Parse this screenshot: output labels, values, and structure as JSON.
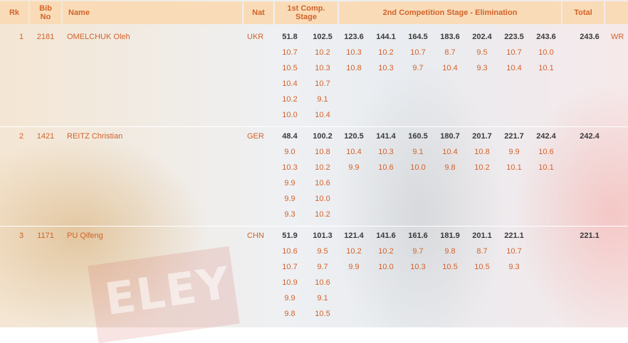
{
  "header": {
    "rank": "Rk",
    "bib_line1": "Bib",
    "bib_line2": "No",
    "name": "Name",
    "nat": "Nat",
    "stage1_line1": "1st Comp.",
    "stage1_line2": "Stage",
    "stage2": "2nd Competition Stage - Elimination",
    "total": "Total"
  },
  "background_logo_text": "ELEY",
  "athletes": [
    {
      "rank": "1",
      "bib": "2181",
      "name": "OMELCHUK Oleh",
      "nat": "UKR",
      "stage1_totals": [
        "51.8",
        "102.5"
      ],
      "stage1_shots": [
        [
          "10.7",
          "10.2"
        ],
        [
          "10.5",
          "10.3"
        ],
        [
          "10.4",
          "10.7"
        ],
        [
          "10.2",
          "9.1"
        ],
        [
          "10.0",
          "10.4"
        ]
      ],
      "stage2_totals": [
        "123.6",
        "144.1",
        "164.5",
        "183.6",
        "202.4",
        "223.5",
        "243.6"
      ],
      "stage2_shots": [
        [
          "10.3",
          "10.2",
          "10.7",
          "8.7",
          "9.5",
          "10.7",
          "10.0"
        ],
        [
          "10.8",
          "10.3",
          "9.7",
          "10.4",
          "9.3",
          "10.4",
          "10.1"
        ]
      ],
      "total": "243.6",
      "record": "WR"
    },
    {
      "rank": "2",
      "bib": "1421",
      "name": "REITZ Christian",
      "nat": "GER",
      "stage1_totals": [
        "48.4",
        "100.2"
      ],
      "stage1_shots": [
        [
          "9.0",
          "10.8"
        ],
        [
          "10.3",
          "10.2"
        ],
        [
          "9.9",
          "10.6"
        ],
        [
          "9.9",
          "10.0"
        ],
        [
          "9.3",
          "10.2"
        ]
      ],
      "stage2_totals": [
        "120.5",
        "141.4",
        "160.5",
        "180.7",
        "201.7",
        "221.7",
        "242.4"
      ],
      "stage2_shots": [
        [
          "10.4",
          "10.3",
          "9.1",
          "10.4",
          "10.8",
          "9.9",
          "10.6"
        ],
        [
          "9.9",
          "10.6",
          "10.0",
          "9.8",
          "10.2",
          "10.1",
          "10.1"
        ]
      ],
      "total": "242.4",
      "record": ""
    },
    {
      "rank": "3",
      "bib": "1171",
      "name": "PU Qifeng",
      "nat": "CHN",
      "stage1_totals": [
        "51.9",
        "101.3"
      ],
      "stage1_shots": [
        [
          "10.6",
          "9.5"
        ],
        [
          "10.7",
          "9.7"
        ],
        [
          "10.9",
          "10.6"
        ],
        [
          "9.9",
          "9.1"
        ],
        [
          "9.8",
          "10.5"
        ]
      ],
      "stage2_totals": [
        "121.4",
        "141.6",
        "161.6",
        "181.9",
        "201.1",
        "221.1"
      ],
      "stage2_shots": [
        [
          "10.2",
          "10.2",
          "9.7",
          "9.8",
          "8.7",
          "10.7"
        ],
        [
          "9.9",
          "10.0",
          "10.3",
          "10.5",
          "10.5",
          "9.3"
        ]
      ],
      "total": "221.1",
      "record": ""
    }
  ]
}
